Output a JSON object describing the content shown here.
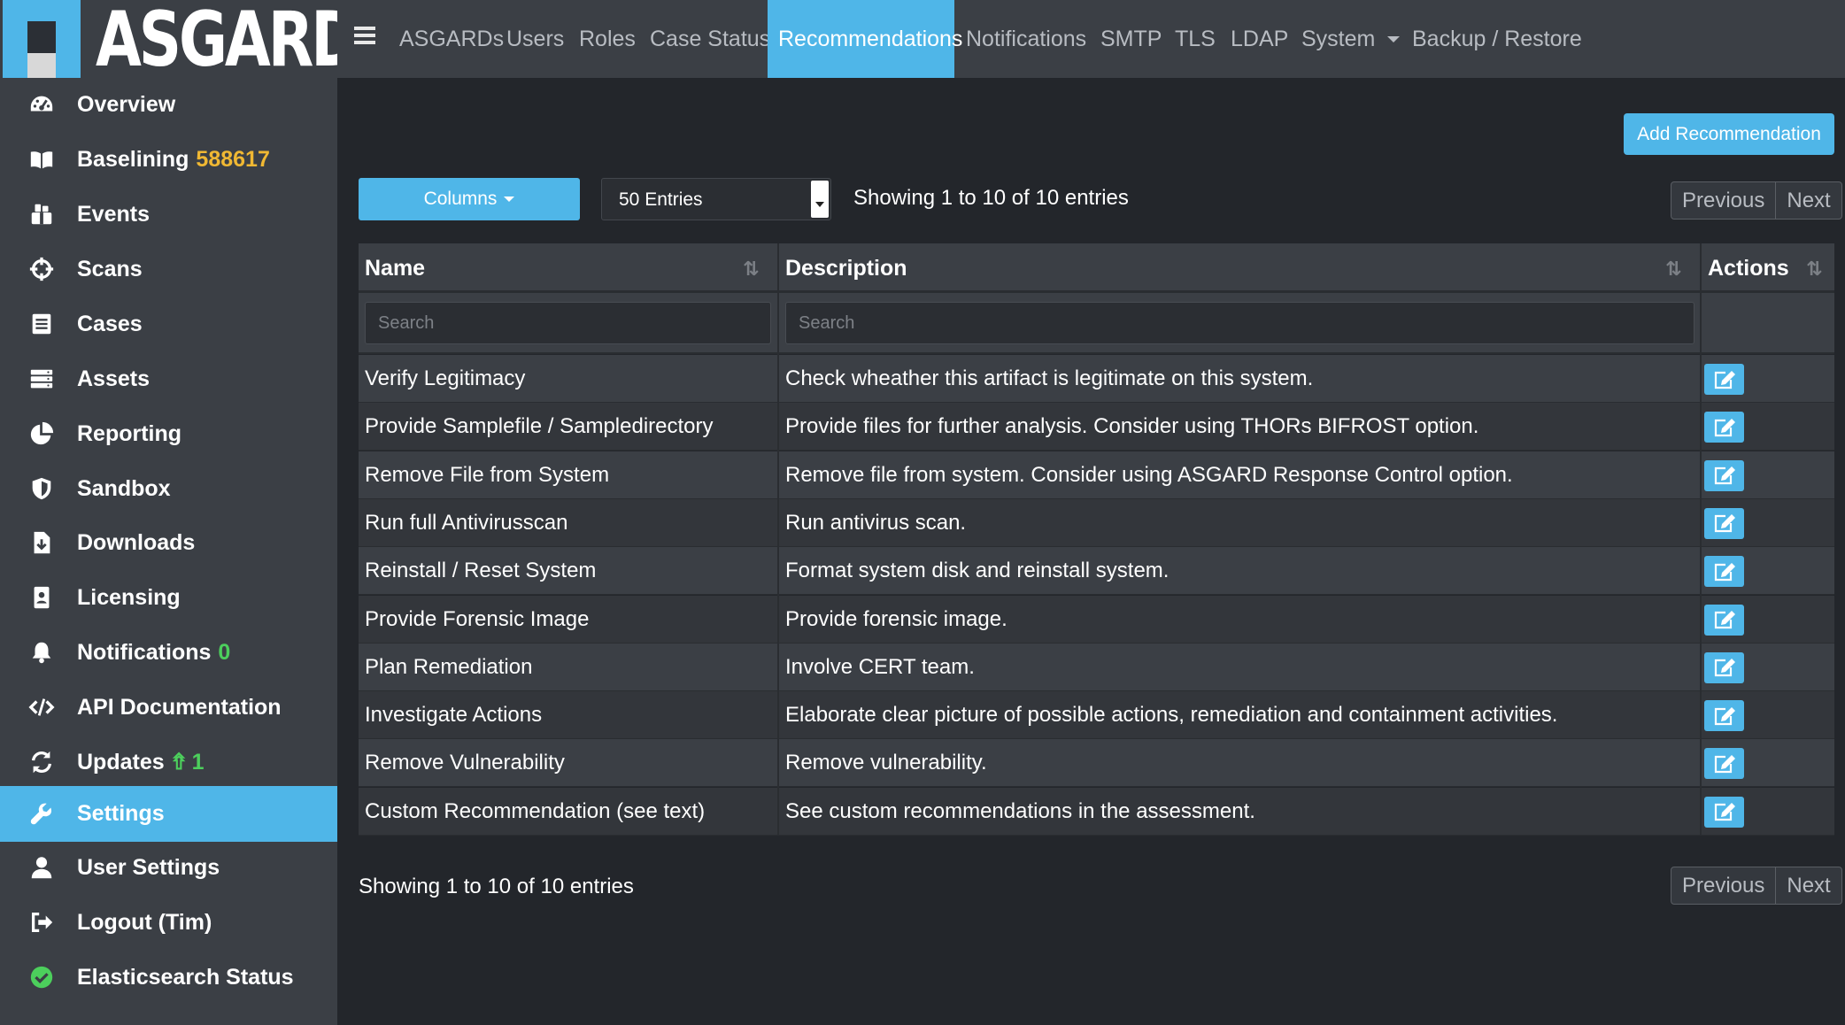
{
  "app": {
    "logo_text": "ASGARD"
  },
  "colors": {
    "accent": "#4fb6e8",
    "sidebar_bg": "#3b3f45",
    "page_bg": "#23262b",
    "badge_yellow": "#f0b833",
    "badge_green": "#4ccf5c"
  },
  "sidebar": {
    "items": [
      {
        "label": "Overview",
        "icon": "dashboard-icon"
      },
      {
        "label": "Baselining",
        "badge": "588617",
        "icon": "book-icon"
      },
      {
        "label": "Events",
        "icon": "events-icon"
      },
      {
        "label": "Scans",
        "icon": "crosshair-icon"
      },
      {
        "label": "Cases",
        "icon": "cases-icon"
      },
      {
        "label": "Assets",
        "icon": "server-icon"
      },
      {
        "label": "Reporting",
        "icon": "pie-chart-icon"
      },
      {
        "label": "Sandbox",
        "icon": "shield-icon"
      },
      {
        "label": "Downloads",
        "icon": "download-file-icon"
      },
      {
        "label": "Licensing",
        "icon": "id-badge-icon"
      },
      {
        "label": "Notifications",
        "badge": "0",
        "icon": "bell-icon"
      },
      {
        "label": "API Documentation",
        "icon": "code-icon"
      },
      {
        "label": "Updates",
        "badge": "1",
        "icon": "sync-icon"
      },
      {
        "label": "Settings",
        "icon": "wrench-icon",
        "active": true
      },
      {
        "label": "User Settings",
        "icon": "user-icon"
      },
      {
        "label": "Logout (Tim)",
        "icon": "logout-icon"
      },
      {
        "label": "Elasticsearch Status",
        "icon": "check-circle-icon"
      }
    ]
  },
  "topnav": {
    "items": [
      {
        "label": "ASGARDs"
      },
      {
        "label": "Users"
      },
      {
        "label": "Roles"
      },
      {
        "label": "Case Status"
      },
      {
        "label": "Recommendations",
        "active": true
      },
      {
        "label": "Notifications"
      },
      {
        "label": "SMTP"
      },
      {
        "label": "TLS"
      },
      {
        "label": "LDAP"
      },
      {
        "label": "System",
        "dropdown": true
      },
      {
        "label": "Backup / Restore"
      }
    ]
  },
  "main": {
    "add_button": "Add Recommendation",
    "columns_button": "Columns",
    "entries_select": "50 Entries",
    "info_top": "Showing 1 to 10 of 10 entries",
    "info_bottom": "Showing 1 to 10 of 10 entries",
    "pager": {
      "previous": "Previous",
      "next": "Next"
    }
  },
  "table": {
    "headers": {
      "name": "Name",
      "description": "Description",
      "actions": "Actions"
    },
    "sort_icon": "⇅",
    "search_placeholder_name": "Search",
    "search_placeholder_description": "Search",
    "rows": [
      {
        "name": "Verify Legitimacy",
        "description": "Check wheather this artifact is legitimate on this system."
      },
      {
        "name": "Provide Samplefile / Sampledirectory",
        "description": "Provide files for further analysis. Consider using THORs BIFROST option."
      },
      {
        "name": "Remove File from System",
        "description": "Remove file from system. Consider using ASGARD Response Control option."
      },
      {
        "name": "Run full Antivirusscan",
        "description": "Run antivirus scan."
      },
      {
        "name": "Reinstall / Reset System",
        "description": "Format system disk and reinstall system."
      },
      {
        "name": "Provide Forensic Image",
        "description": "Provide forensic image."
      },
      {
        "name": "Plan Remediation",
        "description": "Involve CERT team."
      },
      {
        "name": "Investigate Actions",
        "description": "Elaborate clear picture of possible actions, remediation and containment activities."
      },
      {
        "name": "Remove Vulnerability",
        "description": "Remove vulnerability."
      },
      {
        "name": "Custom Recommendation (see text)",
        "description": "See custom recommendations in the assessment."
      }
    ]
  }
}
